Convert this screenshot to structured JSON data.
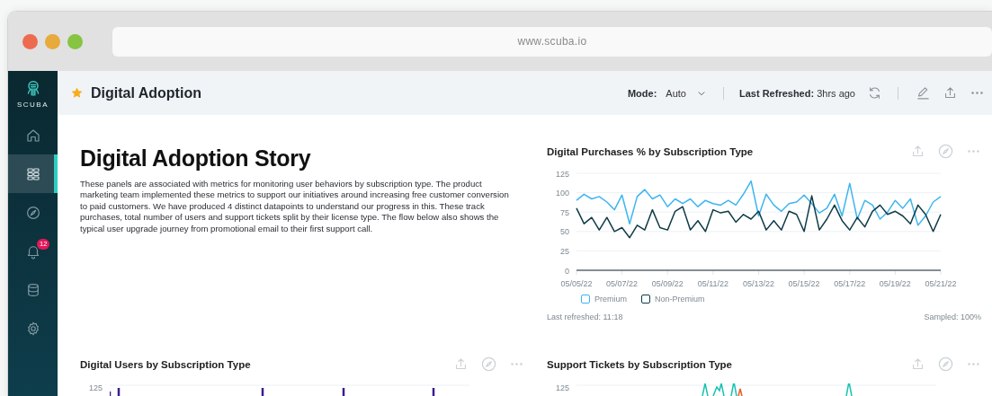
{
  "browser": {
    "url": "www.scuba.io"
  },
  "sidebar": {
    "logo": "SCUBA",
    "items": [
      {
        "kind": "home",
        "selected": false
      },
      {
        "kind": "dashboards",
        "selected": true
      },
      {
        "kind": "compass",
        "selected": false
      },
      {
        "kind": "bell",
        "selected": false,
        "badge": "12"
      },
      {
        "kind": "database",
        "selected": false
      },
      {
        "kind": "settings",
        "selected": false
      }
    ]
  },
  "header": {
    "title": "Digital Adoption",
    "favorite": true,
    "mode_label": "Mode:",
    "mode_value": "Auto",
    "refreshed_label": "Last Refreshed:",
    "refreshed_value": "3hrs ago"
  },
  "story": {
    "title": "Digital Adoption Story",
    "text": "These panels are associated with metrics for monitoring user behaviors by subscription type. The product marketing team implemented these metrics to support our initiatives around increasing free customer conversion to paid customers. We have produced 4 distinct datapoints to understand our progress in this. These track purchases, total number of users and support tickets split by their license type. The flow below also shows the typical user upgrade journey from promotional email to their first support call."
  },
  "panels": [
    {
      "kind": "line",
      "title": "Digital Purchases % by Subscription Type",
      "footer_left": "Last refreshed: 11:18",
      "footer_right": "Sampled: 100%",
      "chart_data": {
        "type": "line",
        "categories": [
          "05/05/22",
          null,
          null,
          null,
          null,
          null,
          "05/07/22",
          null,
          null,
          null,
          null,
          null,
          "05/09/22",
          null,
          null,
          null,
          null,
          null,
          "05/11/22",
          null,
          null,
          null,
          null,
          null,
          "05/13/22",
          null,
          null,
          null,
          null,
          null,
          "05/15/22",
          null,
          null,
          null,
          null,
          null,
          "05/17/22",
          null,
          null,
          null,
          null,
          null,
          "05/19/22",
          null,
          null,
          null,
          null,
          null,
          "05/21/22"
        ],
        "ylim": [
          0,
          125
        ],
        "yticks": [
          0,
          25,
          50,
          75,
          100,
          125
        ],
        "grid": true,
        "legend": "bottom",
        "series": [
          {
            "name": "Premium",
            "color": "#3db5f0",
            "values": [
              90,
              98,
              92,
              95,
              88,
              78,
              97,
              60,
              95,
              104,
              92,
              97,
              82,
              92,
              86,
              92,
              82,
              90,
              86,
              84,
              90,
              84,
              98,
              115,
              70,
              98,
              84,
              76,
              86,
              88,
              97,
              86,
              74,
              80,
              98,
              70,
              112,
              66,
              90,
              84,
              66,
              75,
              90,
              80,
              92,
              58,
              70,
              88,
              95
            ]
          },
          {
            "name": "Non-Premium",
            "color": "#0e3b47",
            "values": [
              80,
              60,
              68,
              52,
              68,
              50,
              55,
              42,
              58,
              52,
              78,
              55,
              52,
              76,
              82,
              52,
              64,
              50,
              78,
              74,
              76,
              62,
              72,
              66,
              76,
              52,
              64,
              52,
              76,
              72,
              50,
              96,
              52,
              66,
              84,
              64,
              52,
              68,
              56,
              76,
              84,
              72,
              76,
              70,
              60,
              84,
              72,
              50,
              72
            ]
          }
        ]
      }
    },
    {
      "kind": "partial",
      "title": "Digital Users by Subscription Type",
      "y_tick": "125"
    },
    {
      "kind": "partial",
      "title": "Support Tickets by Subscription Type",
      "y_tick": "125"
    }
  ]
}
